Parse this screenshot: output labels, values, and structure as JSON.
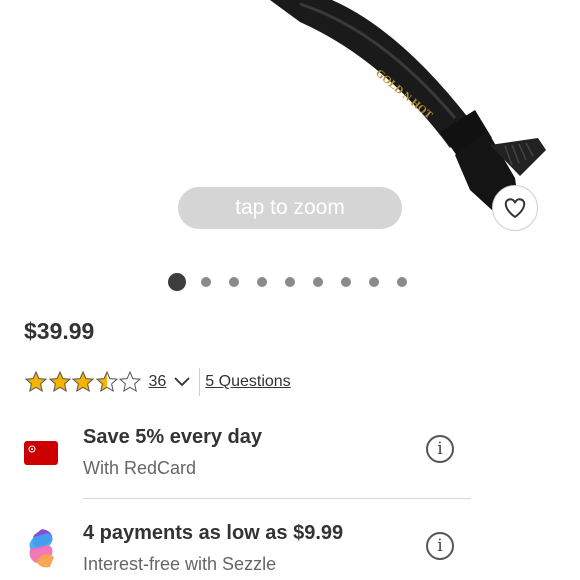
{
  "gallery": {
    "zoom_hint": "tap to zoom",
    "iron_brand_text": "GOLD N HOT",
    "dot_count": 9,
    "active_index": 0
  },
  "product": {
    "price": "$39.99",
    "rating_stars": 3.5,
    "rating_max": 5,
    "review_count": "36",
    "questions_link": "5 Questions"
  },
  "promos": [
    {
      "title": "Save 5% every day",
      "subtitle": "With RedCard",
      "icon": "redcard-icon"
    },
    {
      "title": "4 payments as low as $9.99",
      "subtitle": "Interest-free with Sezzle",
      "icon": "sezzle-icon"
    }
  ],
  "colors": {
    "star": "#f5b400",
    "redcard": "#cc0000"
  }
}
